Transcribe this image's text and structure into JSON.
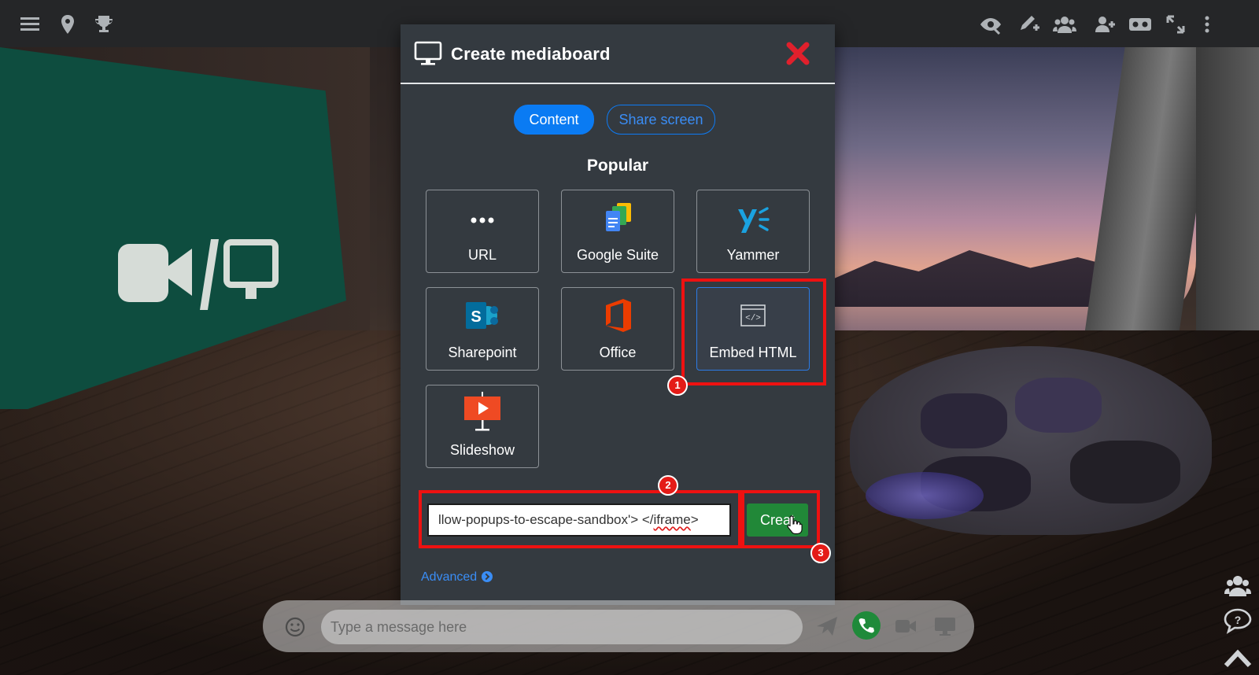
{
  "modal": {
    "title": "Create mediaboard",
    "tabs": [
      {
        "label": "Content",
        "active": true
      },
      {
        "label": "Share screen",
        "active": false
      }
    ],
    "section_title": "Popular",
    "tiles": [
      {
        "label": "URL",
        "icon": "ellipsis-icon"
      },
      {
        "label": "Google Suite",
        "icon": "google-suite-icon"
      },
      {
        "label": "Yammer",
        "icon": "yammer-icon"
      },
      {
        "label": "Sharepoint",
        "icon": "sharepoint-icon"
      },
      {
        "label": "Office",
        "icon": "office-icon"
      },
      {
        "label": "Embed HTML",
        "icon": "code-window-icon",
        "selected": true
      },
      {
        "label": "Slideshow",
        "icon": "slideshow-icon"
      }
    ],
    "embed_input": {
      "value_prefix": "llow-popups-to-escape-sandbox'> </",
      "value_marked": "iframe",
      "value_suffix": ">"
    },
    "create_label": "Creat",
    "advanced_label": "Advanced"
  },
  "annotations": [
    {
      "number": "1",
      "target": "Embed HTML"
    },
    {
      "number": "2",
      "target": "embed input"
    },
    {
      "number": "3",
      "target": "Create"
    }
  ],
  "chat": {
    "placeholder": "Type a message here"
  },
  "colors": {
    "primary": "#0a7bf3",
    "success": "#218838",
    "close": "#e0202c",
    "highlight": "#ee1111",
    "modal_bg": "#343a40",
    "board": "#0e4d3f"
  }
}
